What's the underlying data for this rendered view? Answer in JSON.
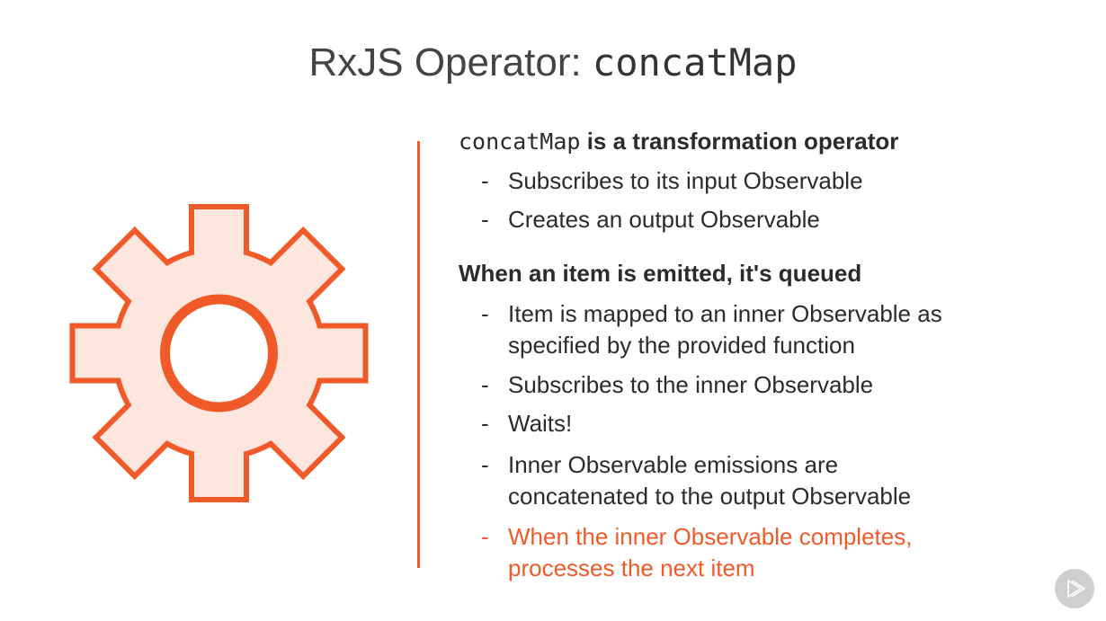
{
  "title": {
    "prefix": "RxJS Operator: ",
    "code": "concatMap"
  },
  "section1": {
    "code": "concatMap",
    "text": " is a transformation operator",
    "bullets": [
      "Subscribes to its input Observable",
      "Creates an output Observable"
    ]
  },
  "section2": {
    "heading": "When an item is emitted, it's queued",
    "bullets": [
      {
        "line1": "Item is mapped to an inner Observable as",
        "line2": "specified by the provided function"
      },
      {
        "line1": "Subscribes to the inner Observable"
      },
      {
        "line1": "Waits!"
      },
      {
        "line1": "Inner Observable emissions are",
        "line2": "concatenated to the output Observable"
      },
      {
        "line1": "When the inner Observable completes,",
        "line2": "processes the next item"
      }
    ]
  },
  "bullet_char": "-",
  "colors": {
    "accent": "#f05a28",
    "gear_fill": "#fce6de"
  },
  "icons": {
    "gear": "gear-icon",
    "play": "play-logo-icon"
  }
}
